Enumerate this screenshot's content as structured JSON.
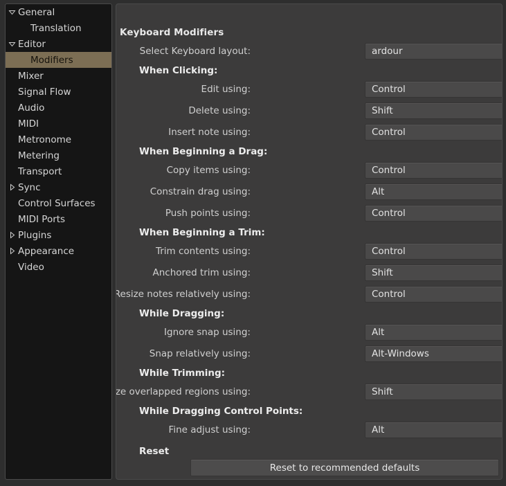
{
  "sidebar": {
    "items": [
      {
        "label": "General",
        "indent": 0,
        "expander": "down",
        "selected": false
      },
      {
        "label": "Translation",
        "indent": 1,
        "expander": "none",
        "selected": false
      },
      {
        "label": "Editor",
        "indent": 0,
        "expander": "down",
        "selected": false
      },
      {
        "label": "Modifiers",
        "indent": 1,
        "expander": "none",
        "selected": true
      },
      {
        "label": "Mixer",
        "indent": 0,
        "expander": "none",
        "selected": false
      },
      {
        "label": "Signal Flow",
        "indent": 0,
        "expander": "none",
        "selected": false
      },
      {
        "label": "Audio",
        "indent": 0,
        "expander": "none",
        "selected": false
      },
      {
        "label": "MIDI",
        "indent": 0,
        "expander": "none",
        "selected": false
      },
      {
        "label": "Metronome",
        "indent": 0,
        "expander": "none",
        "selected": false
      },
      {
        "label": "Metering",
        "indent": 0,
        "expander": "none",
        "selected": false
      },
      {
        "label": "Transport",
        "indent": 0,
        "expander": "none",
        "selected": false
      },
      {
        "label": "Sync",
        "indent": 0,
        "expander": "right",
        "selected": false
      },
      {
        "label": "Control Surfaces",
        "indent": 0,
        "expander": "none",
        "selected": false
      },
      {
        "label": "MIDI Ports",
        "indent": 0,
        "expander": "none",
        "selected": false
      },
      {
        "label": "Plugins",
        "indent": 0,
        "expander": "right",
        "selected": false
      },
      {
        "label": "Appearance",
        "indent": 0,
        "expander": "right",
        "selected": false
      },
      {
        "label": "Video",
        "indent": 0,
        "expander": "none",
        "selected": false
      }
    ]
  },
  "panel": {
    "title": "Keyboard Modifiers",
    "rows": [
      {
        "type": "field",
        "label": "Select Keyboard layout:",
        "value": "ardour"
      },
      {
        "type": "group",
        "label": "When Clicking:"
      },
      {
        "type": "field",
        "label": "Edit using:",
        "value": "Control"
      },
      {
        "type": "field",
        "label": "Delete using:",
        "value": "Shift"
      },
      {
        "type": "field",
        "label": "Insert note using:",
        "value": "Control"
      },
      {
        "type": "group",
        "label": "When Beginning a Drag:"
      },
      {
        "type": "field",
        "label": "Copy items using:",
        "value": "Control"
      },
      {
        "type": "field",
        "label": "Constrain drag using:",
        "value": "Alt"
      },
      {
        "type": "field",
        "label": "Push points using:",
        "value": "Control"
      },
      {
        "type": "group",
        "label": "When Beginning a Trim:"
      },
      {
        "type": "field",
        "label": "Trim contents using:",
        "value": "Control"
      },
      {
        "type": "field",
        "label": "Anchored trim using:",
        "value": "Shift"
      },
      {
        "type": "field",
        "label": "Resize notes relatively using:",
        "value": "Control"
      },
      {
        "type": "group",
        "label": "While Dragging:"
      },
      {
        "type": "field",
        "label": "Ignore snap using:",
        "value": "Alt"
      },
      {
        "type": "field",
        "label": "Snap relatively using:",
        "value": "Alt-Windows"
      },
      {
        "type": "group",
        "label": "While Trimming:"
      },
      {
        "type": "field",
        "label": "Resize overlapped regions using:",
        "value": "Shift"
      },
      {
        "type": "group",
        "label": "While Dragging Control Points:"
      },
      {
        "type": "field",
        "label": "Fine adjust using:",
        "value": "Alt"
      }
    ],
    "reset_label": "Reset",
    "reset_button_label": "Reset to recommended defaults"
  },
  "colors": {
    "window_bg": "#2e2e2e",
    "sidebar_bg": "#151515",
    "panel_bg": "#3c3b3b",
    "selection": "#7c6e54",
    "combo_bg": "#4a4949",
    "text": "#d6d6d6"
  }
}
